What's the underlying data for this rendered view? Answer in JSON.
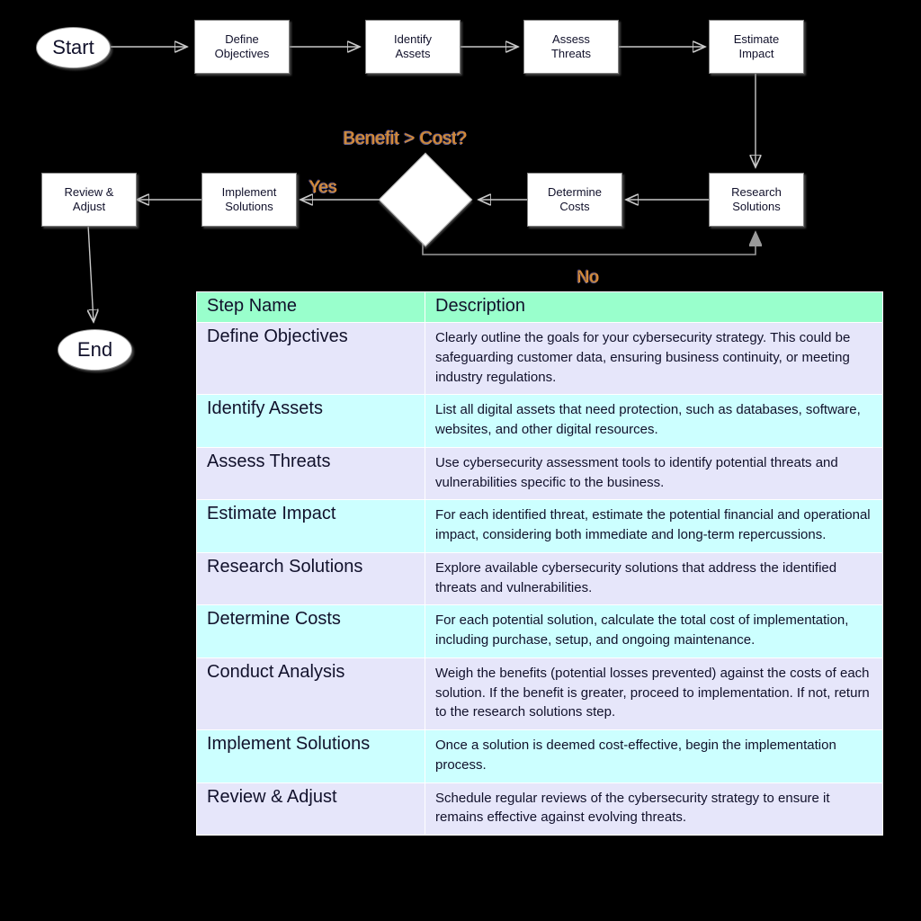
{
  "diagram": {
    "nodes": [
      {
        "id": "start",
        "label": "Start",
        "shape": "ellipse"
      },
      {
        "id": "define",
        "label": "Define\nObjectives",
        "shape": "box"
      },
      {
        "id": "identify",
        "label": "Identify\nAssets",
        "shape": "box"
      },
      {
        "id": "assess",
        "label": "Assess\nThreats",
        "shape": "box"
      },
      {
        "id": "estimate",
        "label": "Estimate\nImpact",
        "shape": "box"
      },
      {
        "id": "research",
        "label": "Research\nSolutions",
        "shape": "box"
      },
      {
        "id": "costs",
        "label": "Determine\nCosts",
        "shape": "box"
      },
      {
        "id": "decision",
        "label": "",
        "shape": "diamond"
      },
      {
        "id": "implement",
        "label": "Implement\nSolutions",
        "shape": "box"
      },
      {
        "id": "review",
        "label": "Review &\nAdjust",
        "shape": "box"
      },
      {
        "id": "end",
        "label": "End",
        "shape": "ellipse"
      }
    ],
    "labels": {
      "decision_question": "Benefit > Cost?",
      "yes": "Yes",
      "no": "No"
    },
    "node_text": {
      "start": "Start",
      "define_line1": "Define",
      "define_line2": "Objectives",
      "identify_line1": "Identify",
      "identify_line2": "Assets",
      "assess_line1": "Assess",
      "assess_line2": "Threats",
      "estimate_line1": "Estimate",
      "estimate_line2": "Impact",
      "research_line1": "Research",
      "research_line2": "Solutions",
      "costs_line1": "Determine",
      "costs_line2": "Costs",
      "implement_line1": "Implement",
      "implement_line2": "Solutions",
      "review_line1": "Review &",
      "review_line2": "Adjust",
      "end": "End"
    },
    "colors": {
      "node_fill": "#ffffff",
      "node_border": "#808080",
      "edge": "#c8c8c8",
      "edge_label": "#c98a3a",
      "background": "#000000"
    }
  },
  "table": {
    "columns": [
      "Step Name",
      "Description"
    ],
    "rows": [
      {
        "step": "Define Objectives",
        "description": "Clearly outline the goals for your cybersecurity strategy. This could be safeguarding customer data, ensuring business continuity, or meeting industry regulations."
      },
      {
        "step": "Identify Assets",
        "description": "List all digital assets that need protection, such as databases, software, websites, and other digital resources."
      },
      {
        "step": "Assess Threats",
        "description": "Use cybersecurity assessment tools to identify potential threats and vulnerabilities specific to the business."
      },
      {
        "step": "Estimate Impact",
        "description": "For each identified threat, estimate the potential financial and operational impact, considering both immediate and long-term repercussions."
      },
      {
        "step": "Research Solutions",
        "description": "Explore available cybersecurity solutions that address the identified threats and vulnerabilities."
      },
      {
        "step": "Determine Costs",
        "description": "For each potential solution, calculate the total cost of implementation, including purchase, setup, and ongoing maintenance."
      },
      {
        "step": "Conduct Analysis",
        "description": "Weigh the benefits (potential losses prevented) against the costs of each solution. If the benefit is greater, proceed to implementation. If not, return to the research solutions step."
      },
      {
        "step": "Implement Solutions",
        "description": "Once a solution is deemed cost-effective, begin the implementation process."
      },
      {
        "step": "Review & Adjust",
        "description": "Schedule regular reviews of the cybersecurity strategy to ensure it remains effective against evolving threats."
      }
    ],
    "colors": {
      "header_bg": "#99ffcc",
      "row_odd_bg": "#e6e6fa",
      "row_even_bg": "#ccffff",
      "text": "#11112b"
    }
  }
}
